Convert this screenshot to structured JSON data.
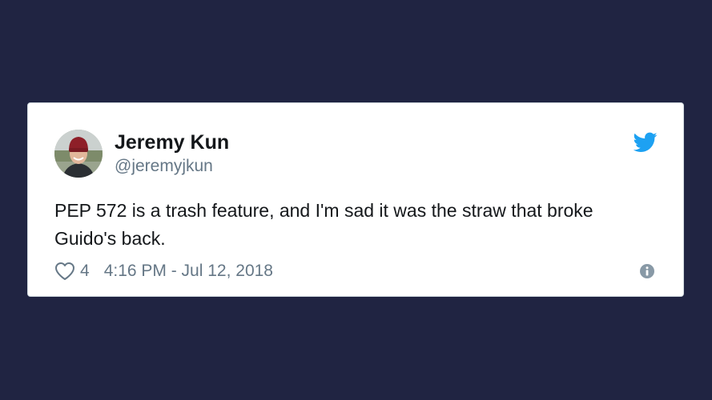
{
  "tweet": {
    "author": {
      "display_name": "Jeremy Kun",
      "handle": "@jeremyjkun"
    },
    "text": "PEP 572 is a trash feature, and I'm sad it was the straw that broke Guido's back.",
    "likes": "4",
    "timestamp": "4:16 PM - Jul 12, 2018"
  },
  "icons": {
    "brand": "twitter-bird-icon",
    "like": "heart-icon",
    "info": "info-icon"
  },
  "colors": {
    "background": "#202442",
    "card": "#ffffff",
    "text_primary": "#14171a",
    "text_secondary": "#657786",
    "twitter_blue": "#1da1f2"
  }
}
